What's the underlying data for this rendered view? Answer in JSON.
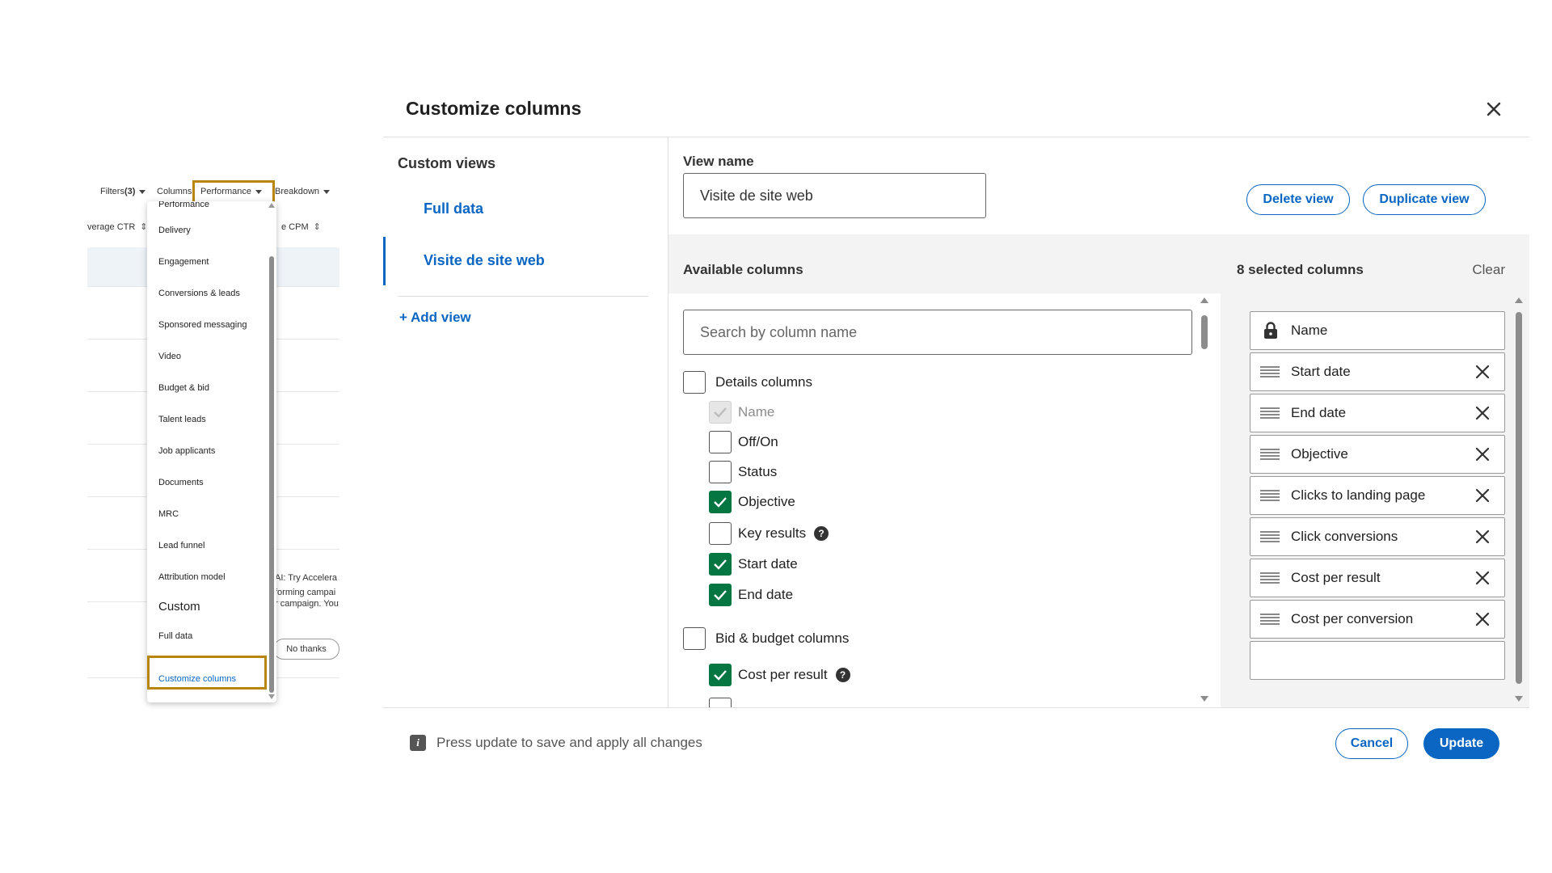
{
  "toolbar": {
    "filters_label": "Filters",
    "filters_count": "(3)",
    "columns_label": "Columns",
    "performance_label": "Performance",
    "breakdown_label": "Breakdown"
  },
  "table": {
    "col_avg_ctr": "verage CTR",
    "col_cpm": "e CPM",
    "promo_title": "AI: Try Accelera",
    "promo_line1": "forming campai",
    "promo_line2": "r campaign. You",
    "no_thanks": "No thanks"
  },
  "dropdown": {
    "cut_top": "Performance",
    "items": [
      "Delivery",
      "Engagement",
      "Conversions & leads",
      "Sponsored messaging",
      "Video",
      "Budget & bid",
      "Talent leads",
      "Job applicants",
      "Documents",
      "MRC",
      "Lead funnel",
      "Attribution model"
    ],
    "custom_group": "Custom",
    "full_data": "Full data",
    "customize_columns": "Customize columns"
  },
  "modal": {
    "title": "Customize columns",
    "custom_views_title": "Custom views",
    "views": [
      "Full data",
      "Visite de site web"
    ],
    "active_view": "Visite de site web",
    "add_view": "+ Add view",
    "view_name_label": "View name",
    "view_name_value": "Visite de site web",
    "delete_view": "Delete view",
    "duplicate_view": "Duplicate view",
    "available_title": "Available columns",
    "selected_title": "8 selected columns",
    "clear": "Clear",
    "search_placeholder": "Search by column name"
  },
  "available": {
    "details_group": "Details columns",
    "details_items": [
      {
        "label": "Name",
        "checked": true,
        "disabled": true,
        "help": false
      },
      {
        "label": "Off/On",
        "checked": false,
        "disabled": false,
        "help": false
      },
      {
        "label": "Status",
        "checked": false,
        "disabled": false,
        "help": false
      },
      {
        "label": "Objective",
        "checked": true,
        "disabled": false,
        "help": false
      },
      {
        "label": "Key results",
        "checked": false,
        "disabled": false,
        "help": true
      },
      {
        "label": "Start date",
        "checked": true,
        "disabled": false,
        "help": false
      },
      {
        "label": "End date",
        "checked": true,
        "disabled": false,
        "help": false
      }
    ],
    "bid_group": "Bid & budget columns",
    "bid_items": [
      {
        "label": "Cost per result",
        "checked": true,
        "disabled": false,
        "help": true
      }
    ]
  },
  "selected": [
    {
      "label": "Name",
      "locked": true
    },
    {
      "label": "Start date",
      "locked": false
    },
    {
      "label": "End date",
      "locked": false
    },
    {
      "label": "Objective",
      "locked": false
    },
    {
      "label": "Clicks to landing page",
      "locked": false
    },
    {
      "label": "Click conversions",
      "locked": false
    },
    {
      "label": "Cost per result",
      "locked": false
    },
    {
      "label": "Cost per conversion",
      "locked": false
    }
  ],
  "footer": {
    "info_text": "Press update to save and apply all changes",
    "cancel": "Cancel",
    "update": "Update"
  },
  "colors": {
    "accent": "#0a66c2",
    "checked": "#057642",
    "highlight_border": "#b8860b"
  }
}
